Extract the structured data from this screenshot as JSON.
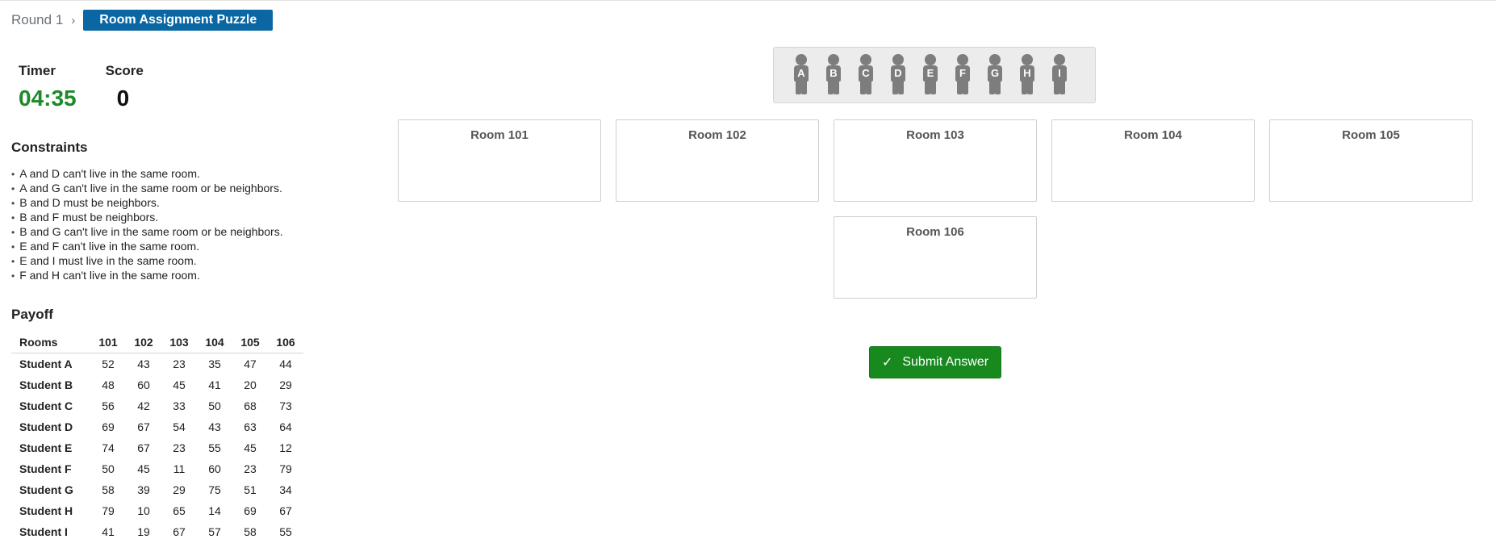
{
  "breadcrumb": {
    "parent": "Round 1",
    "separator": "›",
    "current": "Room Assignment Puzzle"
  },
  "stats": {
    "timer_label": "Timer",
    "timer_value": "04:35",
    "score_label": "Score",
    "score_value": "0"
  },
  "constraints": {
    "title": "Constraints",
    "items": [
      "A and D can't live in the same room.",
      "A and G can't live in the same room or be neighbors.",
      "B and D must be neighbors.",
      "B and F must be neighbors.",
      "B and G can't live in the same room or be neighbors.",
      "E and F can't live in the same room.",
      "E and I must live in the same room.",
      "F and H can't live in the same room."
    ]
  },
  "payoff": {
    "title": "Payoff",
    "header": [
      "Rooms",
      "101",
      "102",
      "103",
      "104",
      "105",
      "106"
    ],
    "rows": [
      [
        "Student A",
        "52",
        "43",
        "23",
        "35",
        "47",
        "44"
      ],
      [
        "Student B",
        "48",
        "60",
        "45",
        "41",
        "20",
        "29"
      ],
      [
        "Student C",
        "56",
        "42",
        "33",
        "50",
        "68",
        "73"
      ],
      [
        "Student D",
        "69",
        "67",
        "54",
        "43",
        "63",
        "64"
      ],
      [
        "Student E",
        "74",
        "67",
        "23",
        "55",
        "45",
        "12"
      ],
      [
        "Student F",
        "50",
        "45",
        "11",
        "60",
        "23",
        "79"
      ],
      [
        "Student G",
        "58",
        "39",
        "29",
        "75",
        "51",
        "34"
      ],
      [
        "Student H",
        "79",
        "10",
        "65",
        "14",
        "69",
        "67"
      ],
      [
        "Student I",
        "41",
        "19",
        "67",
        "57",
        "58",
        "55"
      ]
    ]
  },
  "students": [
    "A",
    "B",
    "C",
    "D",
    "E",
    "F",
    "G",
    "H",
    "I"
  ],
  "rooms": [
    "Room 101",
    "Room 102",
    "Room 103",
    "Room 104",
    "Room 105",
    "Room 106"
  ],
  "submit": {
    "icon": "✓",
    "label": "Submit Answer"
  },
  "colors": {
    "accent": "#0b67a3",
    "timer": "#1d8a2a",
    "submit": "#18891f",
    "student_icon": "#7d7d7d"
  }
}
